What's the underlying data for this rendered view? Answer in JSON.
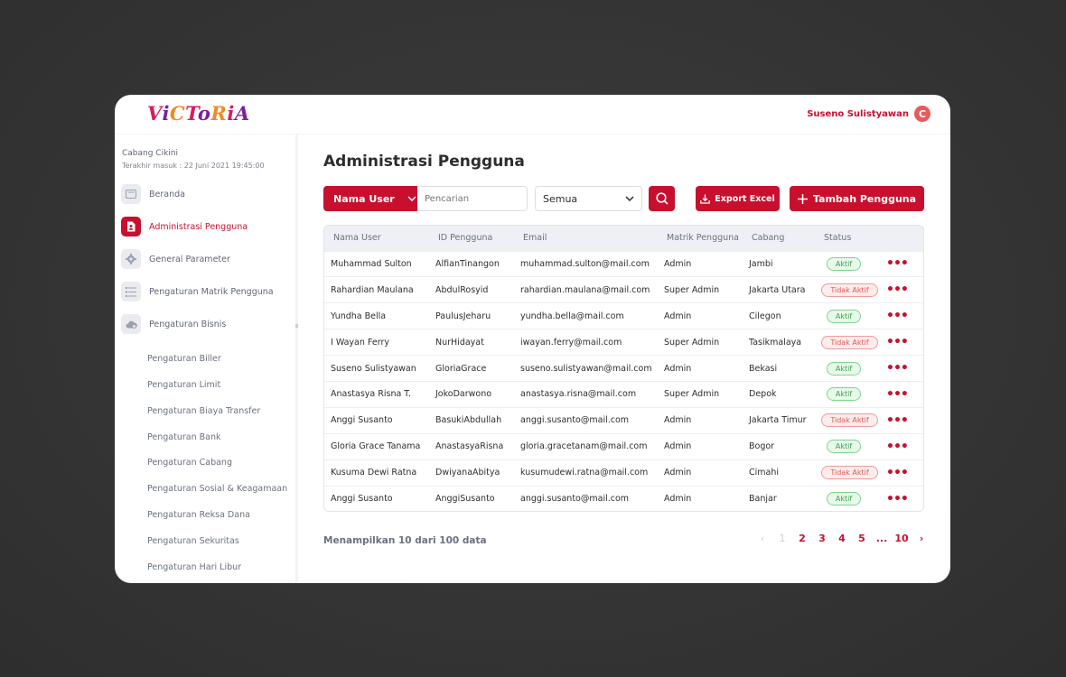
{
  "header": {
    "logo_text": "VICTORIA",
    "user_name": "Suseno Sulistyawan",
    "avatar_initial": "C"
  },
  "sidebar": {
    "branch": "Cabang Cikini",
    "last_login": "Terakhir masuk : 22 Juni 2021 19:45:00",
    "items": [
      {
        "label": "Beranda",
        "icon": "home-icon"
      },
      {
        "label": "Administrasi Pengguna",
        "icon": "user-document-icon",
        "active": true
      },
      {
        "label": "General Parameter",
        "icon": "gear-icon"
      },
      {
        "label": "Pengaturan Matrik Pengguna",
        "icon": "list-icon"
      },
      {
        "label": "Pengaturan Bisnis",
        "icon": "cloud-gear-icon"
      }
    ],
    "sub_items": [
      "Pengaturan Biller",
      "Pengaturan Limit",
      "Pengaturan Biaya Transfer",
      "Pengaturan Bank",
      "Pengaturan Cabang",
      "Pengaturan Sosial & Keagamaan",
      "Pengaturan Reksa Dana",
      "Pengaturan Sekuritas",
      "Pengaturan Hari Libur"
    ]
  },
  "main": {
    "title": "Administrasi Pengguna",
    "filter_label": "Nama User",
    "search_placeholder": "Pencarian",
    "select_value": "Semua",
    "export_label": "Export Excel",
    "add_label": "Tambah Pengguna",
    "columns": [
      "Nama User",
      "ID Pengguna",
      "Email",
      "Matrik Pengguna",
      "Cabang",
      "Status"
    ],
    "rows": [
      {
        "name": "Muhammad Sulton",
        "id": "AlfianTinangon",
        "email": "muhammad.sulton@mail.com",
        "role": "Admin",
        "branch": "Jambi",
        "status": "Aktif",
        "active": true
      },
      {
        "name": "Rahardian Maulana",
        "id": "AbdulRosyid",
        "email": "rahardian.maulana@mail.com",
        "role": "Super Admin",
        "branch": "Jakarta Utara",
        "status": "Tidak Aktif",
        "active": false
      },
      {
        "name": "Yundha Bella",
        "id": "PaulusJeharu",
        "email": "yundha.bella@mail.com",
        "role": "Admin",
        "branch": "Cilegon",
        "status": "Aktif",
        "active": true
      },
      {
        "name": "I Wayan Ferry",
        "id": "NurHidayat",
        "email": "iwayan.ferry@mail.com",
        "role": "Super Admin",
        "branch": "Tasikmalaya",
        "status": "Tidak Aktif",
        "active": false
      },
      {
        "name": "Suseno Sulistyawan",
        "id": "GloriaGrace",
        "email": "suseno.sulistyawan@mail.com",
        "role": "Admin",
        "branch": "Bekasi",
        "status": "Aktif",
        "active": true
      },
      {
        "name": "Anastasya Risna T.",
        "id": "JokoDarwono",
        "email": "anastasya.risna@mail.com",
        "role": "Super Admin",
        "branch": "Depok",
        "status": "Aktif",
        "active": true
      },
      {
        "name": "Anggi Susanto",
        "id": "BasukiAbdullah",
        "email": "anggi.susanto@mail.com",
        "role": "Admin",
        "branch": "Jakarta Timur",
        "status": "Tidak Aktif",
        "active": false
      },
      {
        "name": "Gloria Grace Tanama",
        "id": "AnastasyaRisna",
        "email": "gloria.gracetanam@mail.com",
        "role": "Admin",
        "branch": "Bogor",
        "status": "Aktif",
        "active": true
      },
      {
        "name": "Kusuma Dewi Ratna",
        "id": "DwiyanaAbitya",
        "email": "kusumudewi.ratna@mail.com",
        "role": "Admin",
        "branch": "Cimahi",
        "status": "Tidak Aktif",
        "active": false
      },
      {
        "name": "Anggi Susanto",
        "id": "AnggiSusanto",
        "email": "anggi.susanto@mail.com",
        "role": "Admin",
        "branch": "Banjar",
        "status": "Aktif",
        "active": true
      }
    ],
    "more_symbol": "•••",
    "info": "Menampilkan 10 dari 100 data",
    "pagination": [
      "‹",
      "1",
      "2",
      "3",
      "4",
      "5",
      "...",
      "10",
      "›"
    ]
  },
  "colors": {
    "accent": "#c8102e",
    "active_badge": "#3aa14b",
    "inactive_badge": "#e15757"
  }
}
